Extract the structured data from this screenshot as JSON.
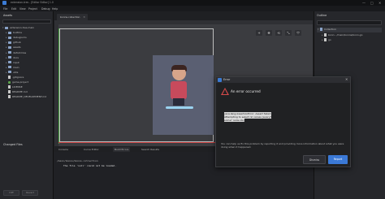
{
  "window": {
    "title": "extension-tres - [Editor Editor] 1.0",
    "minimize": "—",
    "maximize": "□",
    "close": "✕"
  },
  "menu": [
    "File",
    "Edit",
    "View",
    "Project",
    "Debug",
    "Help"
  ],
  "assets": {
    "title": "Assets",
    "items": [
      {
        "label": "extension-tres-main",
        "type": "folder",
        "indent": 0,
        "expanded": true
      },
      {
        "label": "builtins",
        "type": "folder",
        "indent": 1
      },
      {
        "label": "debugiums",
        "type": "folder",
        "indent": 1
      },
      {
        "label": "github",
        "type": "folder",
        "indent": 1
      },
      {
        "label": "assets",
        "type": "folder",
        "indent": 1
      },
      {
        "label": "defold-tres",
        "type": "folder",
        "indent": 1
      },
      {
        "label": "docs",
        "type": "folder",
        "indent": 1
      },
      {
        "label": "input",
        "type": "folder",
        "indent": 1
      },
      {
        "label": "main",
        "type": "folder",
        "indent": 1
      },
      {
        "label": "utils",
        "type": "folder",
        "indent": 1
      },
      {
        "label": ".gitignore",
        "type": "file",
        "indent": 1
      },
      {
        "label": "game.project",
        "type": "game",
        "indent": 1
      },
      {
        "label": "LICENSE",
        "type": "file",
        "indent": 1
      },
      {
        "label": "README.md",
        "type": "file",
        "indent": 1
      },
      {
        "label": "README_DEVELOPMENT.md",
        "type": "file",
        "indent": 1
      }
    ],
    "changed_files": "Changed Files",
    "diff_button": "Diff",
    "revert_button": "Revert"
  },
  "editor_tab": {
    "label": "bonns.collection",
    "close": "✕"
  },
  "toolbar_icons": [
    "+",
    "✥",
    "⟲",
    "⤡",
    "⛉"
  ],
  "bottom_tabs": [
    "Console",
    "Curve Editor",
    "Build Errors",
    "Search Results"
  ],
  "build_errors": {
    "file": "/main/bonns/bonns.collection",
    "error": "The file 'null' could not be loaded."
  },
  "outline": {
    "title": "Outline",
    "items": [
      {
        "label": "Collection",
        "indent": 0
      },
      {
        "label": "bonn - /main/bonns/bonn.go",
        "indent": 1
      },
      {
        "label": "go",
        "indent": 1
      }
    ]
  },
  "error_dialog": {
    "title": "Error",
    "close": "✕",
    "heading": "An error occurred",
    "message": "java.lang.AssertionError: Assert failed: Attempting to select nil values (every? some? node-ids)",
    "help": "You can help us fix this problem by reporting it and providing more information about what you were doing when it happened.",
    "dismiss_label": "Dismiss",
    "report_label": "Report"
  }
}
